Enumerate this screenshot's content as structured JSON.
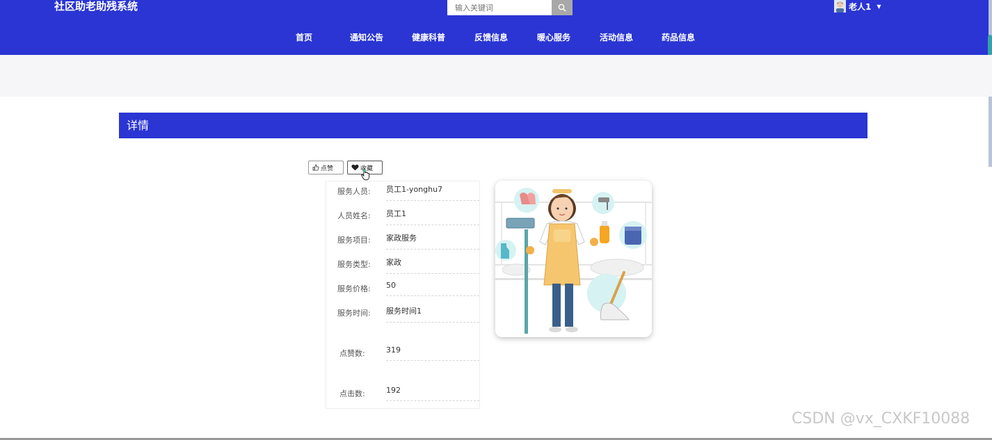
{
  "header": {
    "site_title": "社区助老助残系统",
    "search": {
      "placeholder": "输入关键词",
      "icon": "search-icon"
    },
    "user": {
      "name": "老人1",
      "avatar_icon": "avatar-icon",
      "caret_icon": "caret-down-icon"
    }
  },
  "nav": {
    "items": [
      {
        "label": "首页"
      },
      {
        "label": "通知公告"
      },
      {
        "label": "健康科普"
      },
      {
        "label": "反馈信息"
      },
      {
        "label": "暖心服务"
      },
      {
        "label": "活动信息"
      },
      {
        "label": "药品信息"
      }
    ]
  },
  "detail": {
    "title": "详情",
    "like_label": "点赞",
    "like_icon": "thumbs-up-icon",
    "favorite_label": "收藏",
    "favorite_icon": "heart-icon",
    "fields": [
      {
        "label": "服务人员:",
        "value": "员工1-yonghu7"
      },
      {
        "label": "人员姓名:",
        "value": "员工1"
      },
      {
        "label": "服务项目:",
        "value": "家政服务"
      },
      {
        "label": "服务类型:",
        "value": "家政"
      },
      {
        "label": "服务价格:",
        "value": "50"
      },
      {
        "label": "服务时间:",
        "value": "服务时间1"
      },
      {
        "label": "点赞数:",
        "value": "319"
      },
      {
        "label": "点击数:",
        "value": "192"
      }
    ],
    "image_subject": "housekeeper-illustration"
  },
  "watermark": "CSDN @vx_CXKF10088",
  "colors": {
    "primary": "#2a35d3",
    "band": "#f6f6f8"
  }
}
